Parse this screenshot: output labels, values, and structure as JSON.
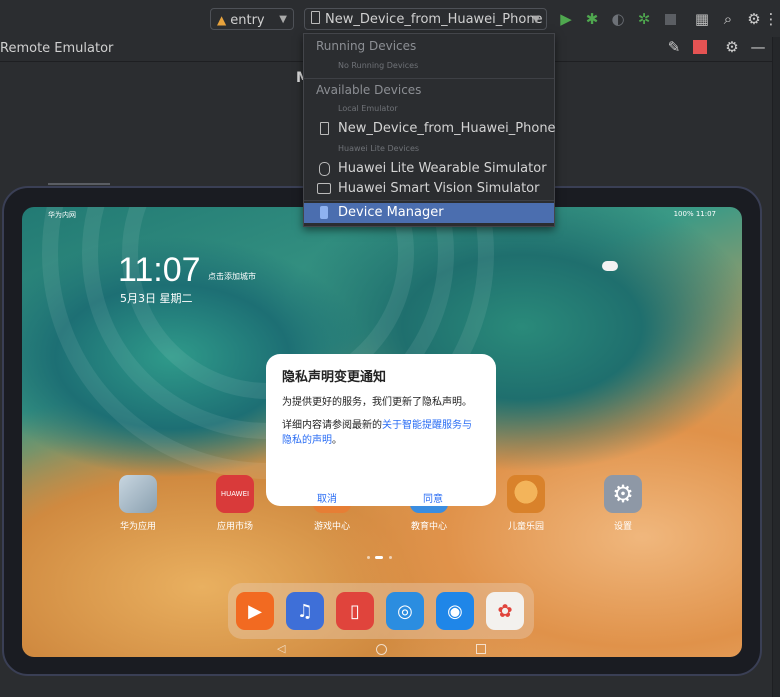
{
  "toolbar": {
    "module_combo": "entry",
    "device_combo": "New_Device_from_Huawei_Phone",
    "icons": [
      "run-icon",
      "debug-icon",
      "attach-debugger-icon",
      "profile-icon",
      "stop-icon",
      "device-manager-icon",
      "search-icon",
      "settings-icon"
    ]
  },
  "panel": {
    "title": "Remote Emulator",
    "partial_heading": "M"
  },
  "dropdown": {
    "running_label": "Running Devices",
    "no_running": "No Running Devices",
    "available_label": "Available Devices",
    "local_emulator": "Local Emulator",
    "phone_device": "New_Device_from_Huawei_Phone",
    "lite_devices": "Huawei Lite Devices",
    "wearable_sim": "Huawei Lite Wearable Simulator",
    "vision_sim": "Huawei Smart Vision Simulator",
    "device_manager": "Device Manager"
  },
  "tablet": {
    "status_left": "华为内网",
    "status_right": "100% 11:07",
    "time": "11:07",
    "lock_hint": "点击添加城市",
    "date": "5月3日 星期二",
    "apps": [
      "华为应用",
      "应用市场",
      "游戏中心",
      "教育中心",
      "儿童乐园",
      "设置"
    ],
    "app_store_text": "HUAWEI"
  },
  "dialog": {
    "title": "隐私声明变更通知",
    "line1": "为提供更好的服务，我们更新了隐私声明。",
    "line2_prefix": "详细内容请参阅最新的",
    "line2_link": "关于智能提醒服务与隐私的声明",
    "line2_suffix": "。",
    "cancel": "取消",
    "agree": "同意"
  },
  "colors": {
    "ide_bg": "#2b2d30",
    "selection": "#4b6eaf",
    "run_green": "#4fa84f",
    "stop_red": "#e55353",
    "link_blue": "#2a6df4"
  }
}
